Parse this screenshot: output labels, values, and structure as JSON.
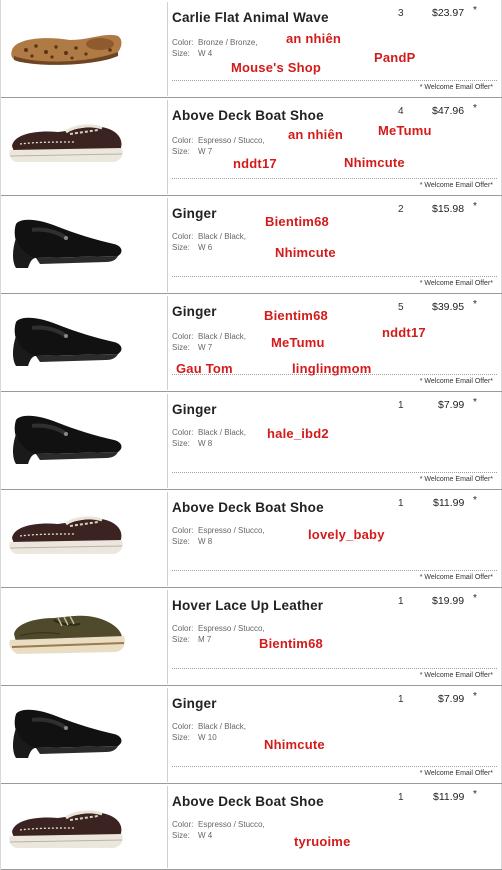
{
  "offer_note": "* Welcome Email Offer*",
  "star": "*",
  "items": [
    {
      "name": "Carlie Flat Animal Wave",
      "color_label": "Color:",
      "color": "Bronze / Bronze,",
      "size_label": "Size:",
      "size": "W 4",
      "qty": "3",
      "price": "$23.97",
      "shoe": "leopard-flat",
      "tags": [
        "an nhiên",
        "PandP",
        "Mouse's Shop"
      ]
    },
    {
      "name": "Above Deck Boat Shoe",
      "color_label": "Color:",
      "color": "Espresso / Stucco,",
      "size_label": "Size:",
      "size": "W 7",
      "qty": "4",
      "price": "$47.96",
      "shoe": "boat",
      "tags": [
        "an nhiên",
        "MeTumu",
        "nddt17",
        "Nhimcute"
      ]
    },
    {
      "name": "Ginger",
      "color_label": "Color:",
      "color": "Black / Black,",
      "size_label": "Size:",
      "size": "W 6",
      "qty": "2",
      "price": "$15.98",
      "shoe": "mary-jane",
      "tags": [
        "Bientim68",
        "Nhimcute"
      ]
    },
    {
      "name": "Ginger",
      "color_label": "Color:",
      "color": "Black / Black,",
      "size_label": "Size:",
      "size": "W 7",
      "qty": "5",
      "price": "$39.95",
      "shoe": "mary-jane",
      "tags": [
        "Bientim68",
        "nddt17",
        "MeTumu",
        "Gau Tom",
        "linglingmom"
      ]
    },
    {
      "name": "Ginger",
      "color_label": "Color:",
      "color": "Black / Black,",
      "size_label": "Size:",
      "size": "W 8",
      "qty": "1",
      "price": "$7.99",
      "shoe": "mary-jane",
      "tags": [
        "hale_ibd2"
      ]
    },
    {
      "name": "Above Deck Boat Shoe",
      "color_label": "Color:",
      "color": "Espresso / Stucco,",
      "size_label": "Size:",
      "size": "W 8",
      "qty": "1",
      "price": "$11.99",
      "shoe": "boat",
      "tags": [
        "lovely_baby"
      ]
    },
    {
      "name": "Hover Lace Up Leather",
      "color_label": "Color:",
      "color": "Espresso / Stucco,",
      "size_label": "Size:",
      "size": "M 7",
      "qty": "1",
      "price": "$19.99",
      "shoe": "sneaker",
      "tags": [
        "Bientim68"
      ]
    },
    {
      "name": "Ginger",
      "color_label": "Color:",
      "color": "Black / Black,",
      "size_label": "Size:",
      "size": "W 10",
      "qty": "1",
      "price": "$7.99",
      "shoe": "mary-jane",
      "tags": [
        "Nhimcute"
      ]
    },
    {
      "name": "Above Deck Boat Shoe",
      "color_label": "Color:",
      "color": "Espresso / Stucco,",
      "size_label": "Size:",
      "size": "W 4",
      "qty": "1",
      "price": "$11.99",
      "shoe": "boat",
      "tags": [
        "tyruoime"
      ]
    }
  ]
}
